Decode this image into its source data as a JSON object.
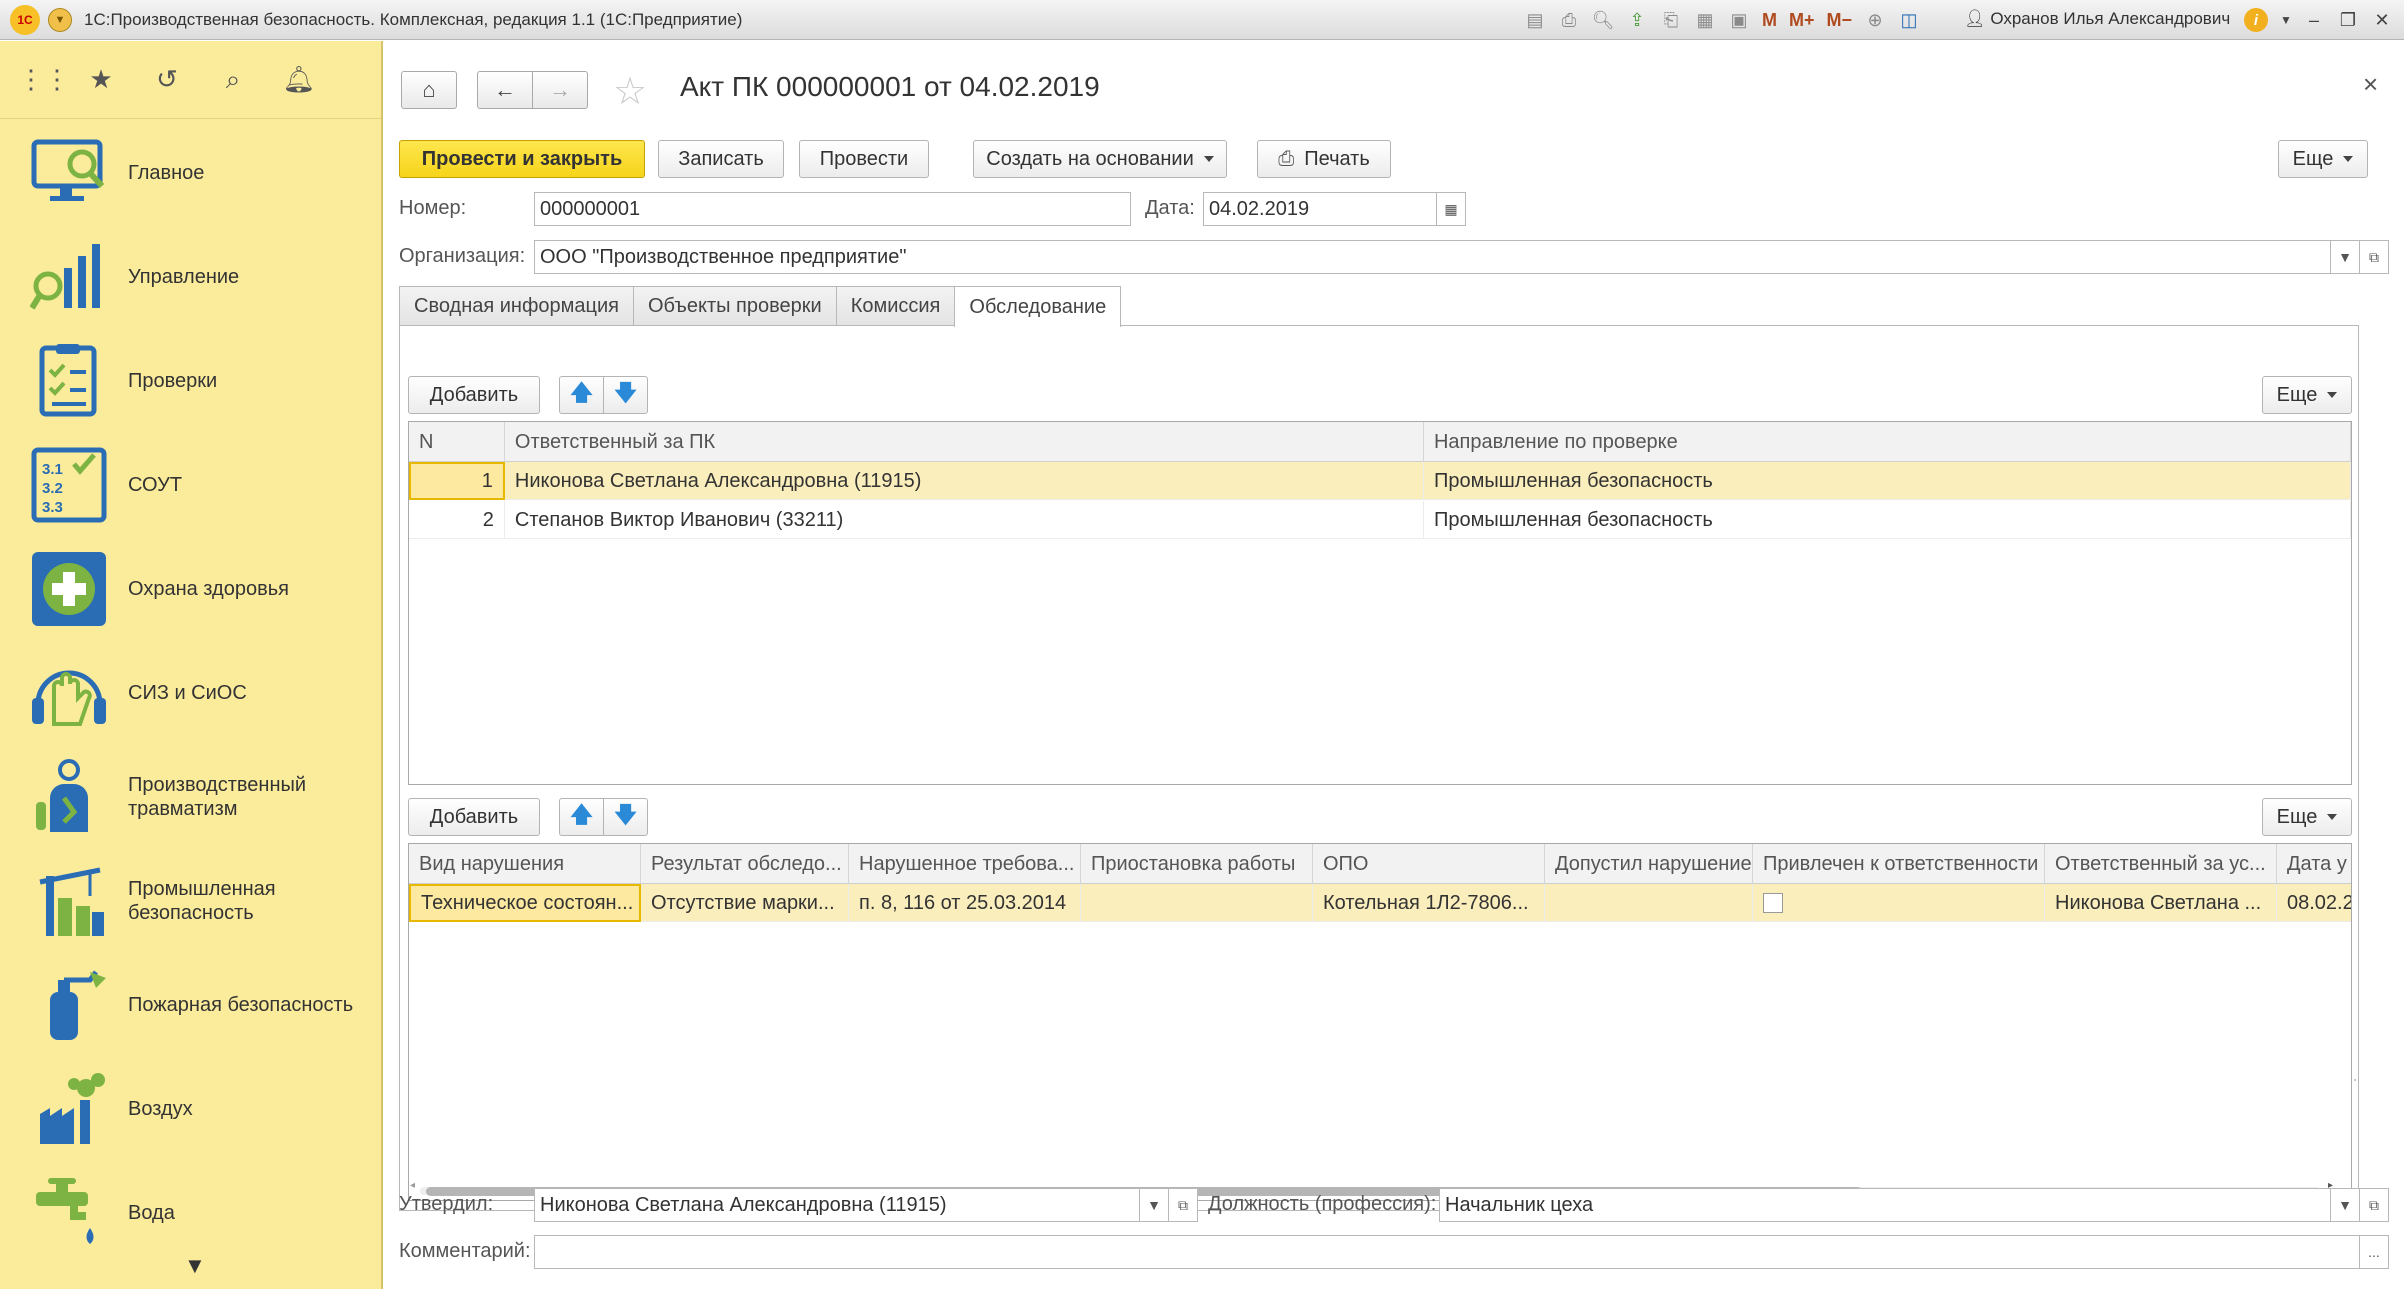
{
  "app": {
    "title": "1С:Производственная безопасность. Комплексная, редакция 1.1  (1С:Предприятие)",
    "logo_text": "1С",
    "user": "Охранов Илья Александрович",
    "toolbar_icons": [
      "save-icon",
      "print-icon",
      "preview-icon",
      "upload-icon",
      "print-to-icon",
      "calculator-icon",
      "calendar-icon"
    ],
    "memory_buttons": [
      "M",
      "M+",
      "M−"
    ],
    "window_controls": [
      "–",
      "❐",
      "✕"
    ]
  },
  "sidebar": {
    "top_icons": [
      "apps-grid-icon",
      "favorites-star-icon",
      "history-icon",
      "search-icon",
      "notifications-bell-icon"
    ],
    "items": [
      {
        "label": "Главное",
        "icon": "monitor-icon"
      },
      {
        "label": "Управление",
        "icon": "bar-chart-icon"
      },
      {
        "label": "Проверки",
        "icon": "checklist-icon"
      },
      {
        "label": "СОУТ",
        "icon": "sout-numbers-icon"
      },
      {
        "label": "Охрана здоровья",
        "icon": "medical-cross-icon"
      },
      {
        "label": "СИЗ и СиОС",
        "icon": "protective-gear-icon"
      },
      {
        "label": "Производственный травматизм",
        "icon": "injured-worker-icon"
      },
      {
        "label": "Промышленная безопасность",
        "icon": "industrial-crane-icon"
      },
      {
        "label": "Пожарная безопасность",
        "icon": "fire-extinguisher-icon"
      },
      {
        "label": "Воздух",
        "icon": "factory-air-icon"
      },
      {
        "label": "Вода",
        "icon": "water-tap-icon"
      }
    ],
    "more_arrow": "▼"
  },
  "doc": {
    "title": "Акт ПК 000000001 от 04.02.2019",
    "close": "×",
    "home": "⌂",
    "back": "←",
    "forward": "→",
    "star": "☆"
  },
  "commands": {
    "post_close": "Провести и закрыть",
    "save": "Записать",
    "post": "Провести",
    "create_based": "Создать на основании",
    "print": "Печать",
    "more": "Еще"
  },
  "header_fields": {
    "number_label": "Номер:",
    "number_value": "000000001",
    "date_label": "Дата:",
    "date_value": "04.02.2019",
    "org_label": "Организация:",
    "org_value": "ООО \"Производственное предприятие\""
  },
  "tabs": [
    "Сводная информация",
    "Объекты проверки",
    "Комиссия",
    "Обследование"
  ],
  "active_tab": "Обследование",
  "table1": {
    "add": "Добавить",
    "more": "Еще",
    "columns": [
      "N",
      "Ответственный за ПК",
      "Направление по проверке"
    ],
    "rows": [
      {
        "n": "1",
        "person": "Никонова Светлана Александровна (11915)",
        "direction": "Промышленная безопасность"
      },
      {
        "n": "2",
        "person": "Степанов Виктор Иванович (33211)",
        "direction": "Промышленная безопасность"
      }
    ]
  },
  "table2": {
    "add": "Добавить",
    "more": "Еще",
    "columns": [
      "Вид нарушения",
      "Результат обследо...",
      "Нарушенное требова...",
      "Приостановка работы",
      "ОПО",
      "Допустил нарушение",
      "Привлечен к ответственности",
      "Ответственный за ус...",
      "Дата у"
    ],
    "rows": [
      {
        "type": "Техническое состоян...",
        "result": "Отсутствие марки...",
        "requirement": "п. 8, 116 от 25.03.2014",
        "suspension": "",
        "opo": "Котельная 1Л2-7806...",
        "violator": "",
        "liable": false,
        "responsible": "Никонова Светлана ...",
        "date": "08.02.2"
      }
    ]
  },
  "footer_fields": {
    "approved_label": "Утвердил:",
    "approved_value": "Никонова Светлана Александровна (11915)",
    "position_label": "Должность (профессия):",
    "position_value": "Начальник цеха",
    "comment_label": "Комментарий:",
    "comment_value": "",
    "comment_btn": "..."
  },
  "colors": {
    "sidebar_bg": "#fbec9c",
    "primary_button": "#f7d41a",
    "selected_row": "#fbeebd",
    "icon_blue": "#2a6db5",
    "icon_green": "#7cb342"
  }
}
